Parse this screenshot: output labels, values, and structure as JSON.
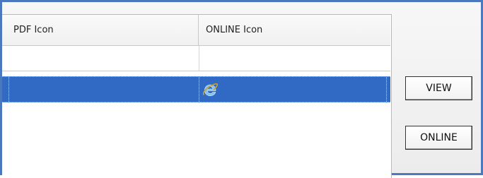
{
  "grid": {
    "columns": [
      "PDF Icon",
      "ONLINE Icon"
    ],
    "rows": [
      {
        "pdf_icon": "",
        "online_icon": ""
      },
      {
        "pdf_icon": "",
        "online_icon": "internet-explorer-icon",
        "selected": true
      }
    ]
  },
  "buttons": {
    "view": "VIEW",
    "online": "ONLINE"
  },
  "colors": {
    "selection": "#316ac5",
    "frame_border": "#4a79c0"
  }
}
